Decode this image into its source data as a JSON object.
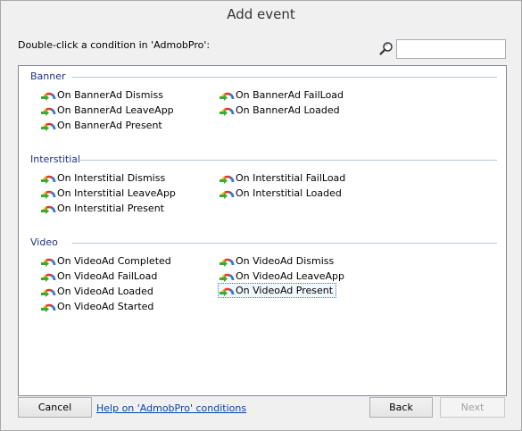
{
  "window": {
    "title": "Add event"
  },
  "prompt": "Double-click a condition in 'AdmobPro':",
  "search": {
    "value": "",
    "placeholder": ""
  },
  "groups": [
    {
      "title": "Banner",
      "items": [
        {
          "label": "On BannerAd Dismiss"
        },
        {
          "label": "On BannerAd FailLoad"
        },
        {
          "label": "On BannerAd LeaveApp"
        },
        {
          "label": "On BannerAd Loaded"
        },
        {
          "label": "On BannerAd Present"
        }
      ]
    },
    {
      "title": "Interstitial",
      "items": [
        {
          "label": "On Interstitial Dismiss"
        },
        {
          "label": "On Interstitial FailLoad"
        },
        {
          "label": "On Interstitial LeaveApp"
        },
        {
          "label": "On Interstitial Loaded"
        },
        {
          "label": "On Interstitial Present"
        }
      ]
    },
    {
      "title": "Video",
      "items": [
        {
          "label": "On VideoAd Completed"
        },
        {
          "label": "On VideoAd Dismiss"
        },
        {
          "label": "On VideoAd FailLoad"
        },
        {
          "label": "On VideoAd LeaveApp"
        },
        {
          "label": "On VideoAd Loaded"
        },
        {
          "label": "On VideoAd Present",
          "selected": true
        },
        {
          "label": "On VideoAd Started"
        }
      ]
    }
  ],
  "footer": {
    "cancel_label": "Cancel",
    "help_label": "Help on 'AdmobPro' conditions",
    "back_label": "Back",
    "next_label": "Next"
  },
  "colors": {
    "group_title": "#1e3287",
    "link": "#0645ad",
    "selection_border": "#4a74c7"
  }
}
